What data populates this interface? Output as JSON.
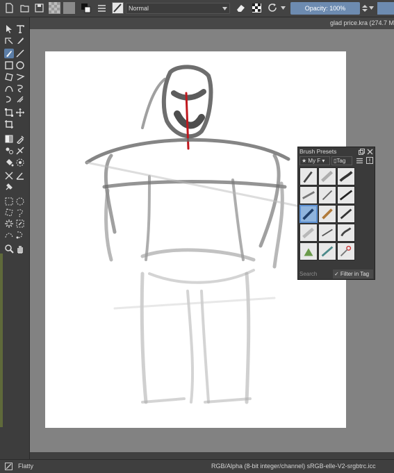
{
  "toolbar": {
    "blend_mode": "Normal",
    "opacity_label": "Opacity: 100%",
    "icons": [
      "new-document-icon",
      "open-document-icon",
      "save-icon",
      "gradient-swatch-icon",
      "pattern-swatch-icon",
      "swap-colors-icon",
      "brush-settings-icon",
      "brush-preset-icon",
      "eraser-icon",
      "alpha-lock-icon",
      "reload-icon"
    ]
  },
  "document": {
    "tab_title": "glad price.kra (274.7 M"
  },
  "brush_presets": {
    "title": "Brush Presets",
    "tag_label": "My F",
    "tag_button": "Tag",
    "search_placeholder": "Search",
    "filter_label": "✓ Filter in Tag"
  },
  "status": {
    "brush_name": "Flatty",
    "color_info": "RGB/Alpha (8-bit integer/channel)  sRGB-elle-V2-srgbtrc.icc"
  },
  "colors": {
    "accent": "#5c7ea7",
    "opacity_bg": "#6d8bb0",
    "canvas_bg": "#828282",
    "sketch_red": "#c0181e"
  }
}
